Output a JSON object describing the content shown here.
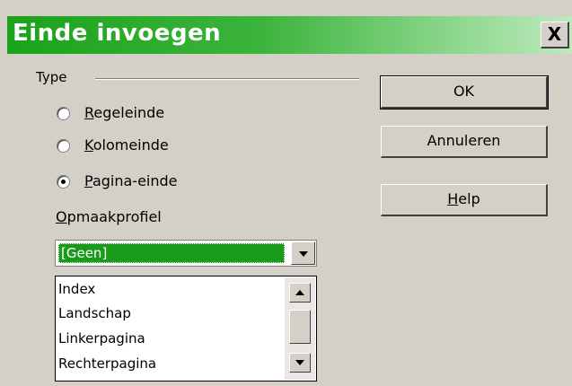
{
  "window": {
    "title": "Einde invoegen",
    "close_label": "X"
  },
  "type_group": {
    "label": "Type",
    "options": [
      {
        "underline": "R",
        "rest": "egeleinde",
        "selected": false
      },
      {
        "underline": "K",
        "rest": "olomeinde",
        "selected": false
      },
      {
        "underline": "P",
        "rest": "agina-einde",
        "selected": true
      }
    ]
  },
  "style": {
    "label_underline": "O",
    "label_rest": "pmaakprofiel",
    "selected_value": "[Geen]",
    "list_items": [
      "Index",
      "Landschap",
      "Linkerpagina",
      "Rechterpagina"
    ]
  },
  "buttons": {
    "ok": "OK",
    "cancel": "Annuleren",
    "help_underline": "H",
    "help_rest": "elp"
  },
  "colors": {
    "title_green": "#1aa31a",
    "selection_green": "#1a9a1a",
    "dialog_bg": "#d4d0c8"
  }
}
